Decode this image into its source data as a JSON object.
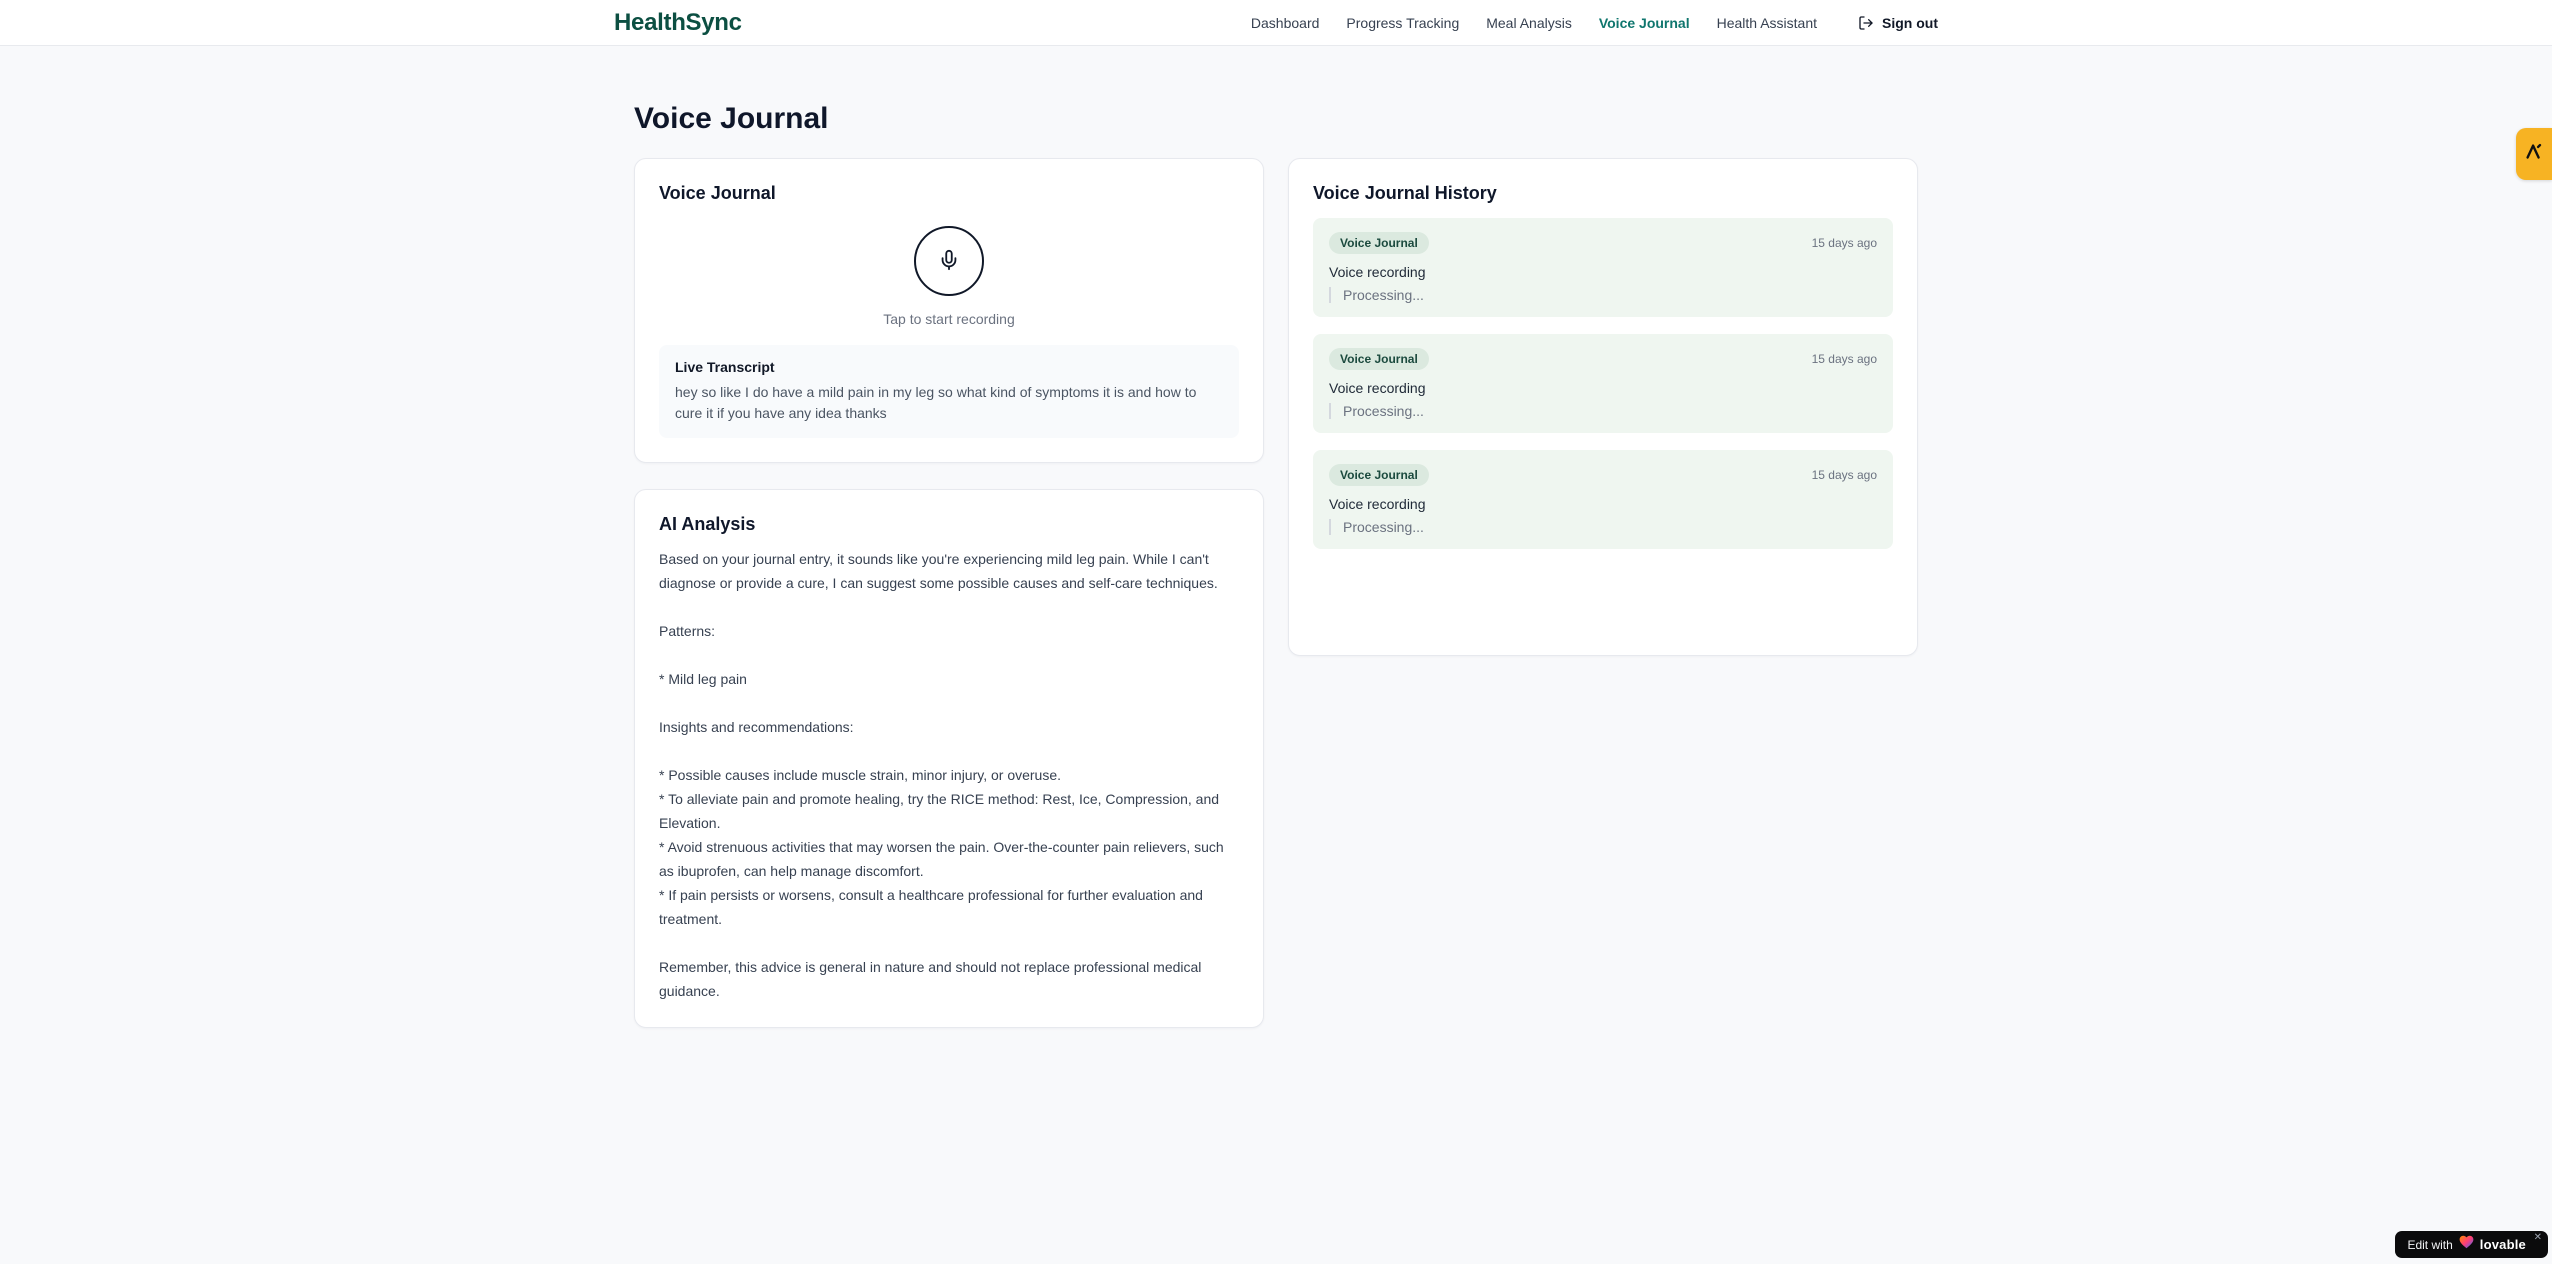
{
  "brand": {
    "name": "HealthSync"
  },
  "nav": {
    "items": [
      {
        "label": "Dashboard",
        "active": false
      },
      {
        "label": "Progress Tracking",
        "active": false
      },
      {
        "label": "Meal Analysis",
        "active": false
      },
      {
        "label": "Voice Journal",
        "active": true
      },
      {
        "label": "Health Assistant",
        "active": false
      }
    ],
    "signout_label": "Sign out"
  },
  "page": {
    "title": "Voice Journal"
  },
  "recorder": {
    "card_title": "Voice Journal",
    "tap_hint": "Tap to start recording",
    "transcript_title": "Live Transcript",
    "transcript_text": "hey so like I do have a mild pain in my leg so what kind of symptoms it is and how to cure it if you have any idea thanks"
  },
  "analysis": {
    "card_title": "AI Analysis",
    "body": "Based on your journal entry, it sounds like you're experiencing mild leg pain. While I can't diagnose or provide a cure, I can suggest some possible causes and self-care techniques.\n\nPatterns:\n\n* Mild leg pain\n\nInsights and recommendations:\n\n* Possible causes include muscle strain, minor injury, or overuse.\n* To alleviate pain and promote healing, try the RICE method: Rest, Ice, Compression, and Elevation.\n* Avoid strenuous activities that may worsen the pain. Over-the-counter pain relievers, such as ibuprofen, can help manage discomfort.\n* If pain persists or worsens, consult a healthcare professional for further evaluation and treatment.\n\nRemember, this advice is general in nature and should not replace professional medical guidance."
  },
  "history": {
    "title": "Voice Journal History",
    "entries": [
      {
        "badge": "Voice Journal",
        "time": "15 days ago",
        "label": "Voice recording",
        "status": "Processing..."
      },
      {
        "badge": "Voice Journal",
        "time": "15 days ago",
        "label": "Voice recording",
        "status": "Processing..."
      },
      {
        "badge": "Voice Journal",
        "time": "15 days ago",
        "label": "Voice recording",
        "status": "Processing..."
      }
    ]
  },
  "floating": {
    "edit_with": "Edit with",
    "lovable": "lovable",
    "close": "✕"
  },
  "icons": {
    "microphone": "mic-icon",
    "logout": "logout-icon",
    "heart": "gradient-heart-icon",
    "lovable_mark": "lovable-a-mark-icon"
  },
  "colors": {
    "brand_green": "#0c4f42",
    "active_nav_teal": "#0f766e",
    "page_background": "#f8f9fb",
    "history_entry_green": "#eff6f0",
    "badge_green": "#dbe9df",
    "edge_tab_amber": "#f7b323",
    "lovable_black": "#0b0b0c"
  }
}
